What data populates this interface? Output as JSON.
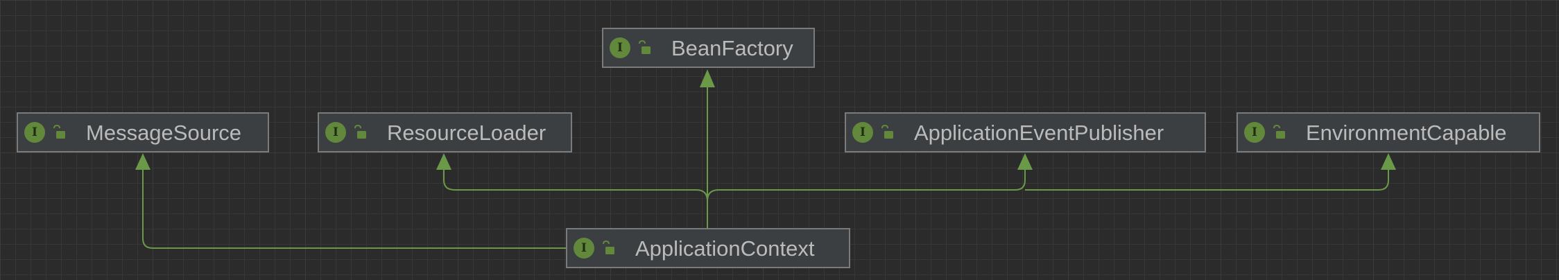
{
  "diagram": {
    "nodes": [
      {
        "id": "bean-factory",
        "label": "BeanFactory",
        "badge": "I",
        "badge_icon": "interface-icon",
        "visibility_icon": "public-lock-icon"
      },
      {
        "id": "message-source",
        "label": "MessageSource",
        "badge": "I",
        "badge_icon": "interface-icon",
        "visibility_icon": "public-lock-icon"
      },
      {
        "id": "resource-loader",
        "label": "ResourceLoader",
        "badge": "I",
        "badge_icon": "interface-icon",
        "visibility_icon": "public-lock-icon"
      },
      {
        "id": "application-event-publisher",
        "label": "ApplicationEventPublisher",
        "badge": "I",
        "badge_icon": "interface-icon",
        "visibility_icon": "public-lock-icon"
      },
      {
        "id": "environment-capable",
        "label": "EnvironmentCapable",
        "badge": "I",
        "badge_icon": "interface-icon",
        "visibility_icon": "public-lock-icon"
      },
      {
        "id": "application-context",
        "label": "ApplicationContext",
        "badge": "I",
        "badge_icon": "interface-icon",
        "visibility_icon": "public-lock-icon"
      }
    ],
    "edges": [
      {
        "from": "application-context",
        "to": "bean-factory",
        "kind": "extends"
      },
      {
        "from": "application-context",
        "to": "message-source",
        "kind": "extends"
      },
      {
        "from": "application-context",
        "to": "resource-loader",
        "kind": "extends"
      },
      {
        "from": "application-context",
        "to": "application-event-publisher",
        "kind": "extends"
      },
      {
        "from": "application-context",
        "to": "environment-capable",
        "kind": "extends"
      }
    ],
    "colors": {
      "background": "#2b2b2b",
      "node_fill": "#3c3f41",
      "node_border": "#7b7b7b",
      "edge": "#6a9a48",
      "badge": "#62883c",
      "text": "#bbbbbb"
    }
  }
}
